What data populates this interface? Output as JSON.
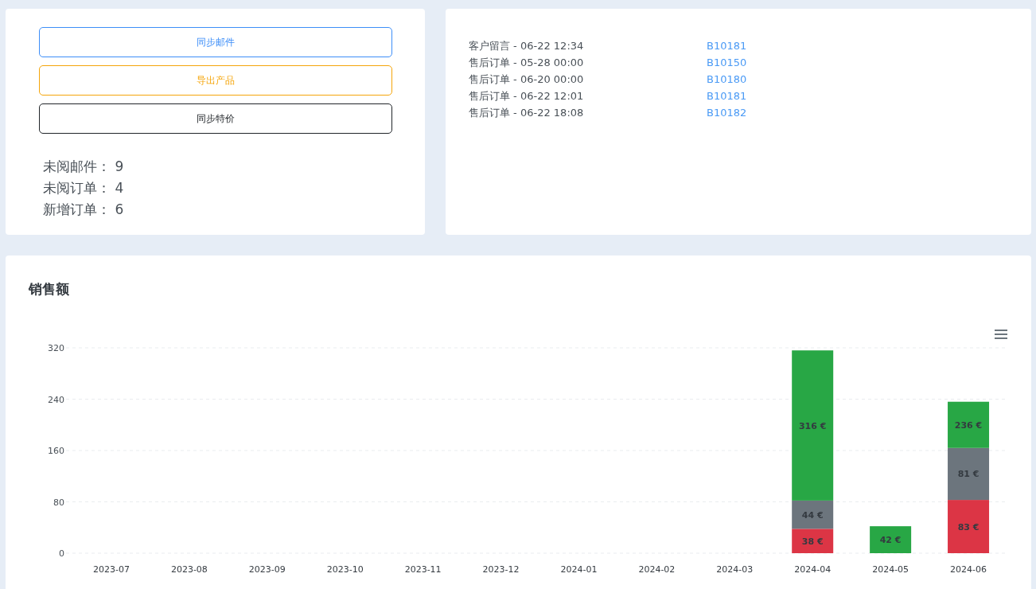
{
  "actions": [
    {
      "label": "同步邮件",
      "color": "#3d8ef8"
    },
    {
      "label": "导出产品",
      "color": "#f5a50a"
    },
    {
      "label": "同步特价",
      "color": "#212529"
    }
  ],
  "stats": [
    {
      "label": "未阅邮件：",
      "value": "9"
    },
    {
      "label": "未阅订单：",
      "value": "4"
    },
    {
      "label": "新增订单：",
      "value": "6"
    }
  ],
  "notifications": [
    {
      "text": "客户留言 - 06-22 12:34",
      "link": "B10181"
    },
    {
      "text": "售后订单 - 05-28 00:00",
      "link": "B10150"
    },
    {
      "text": "售后订单 - 06-20 00:00",
      "link": "B10180"
    },
    {
      "text": "售后订单 - 06-22 12:01",
      "link": "B10181"
    },
    {
      "text": "售后订单 - 06-22 18:08",
      "link": "B10182"
    }
  ],
  "sales": {
    "title": "销售额",
    "chart_data": {
      "type": "bar",
      "stacked": true,
      "categories": [
        "2023-07",
        "2023-08",
        "2023-09",
        "2023-10",
        "2023-11",
        "2023-12",
        "2024-01",
        "2024-02",
        "2024-03",
        "2024-04",
        "2024-05",
        "2024-06"
      ],
      "series": [
        {
          "color": "#dc3545",
          "values": [
            0,
            0,
            0,
            0,
            0,
            0,
            0,
            0,
            0,
            38,
            0,
            83
          ]
        },
        {
          "color": "#6c757d",
          "values": [
            0,
            0,
            0,
            0,
            0,
            0,
            0,
            0,
            0,
            44,
            0,
            81
          ]
        },
        {
          "color": "#28a745",
          "values": [
            0,
            0,
            0,
            0,
            0,
            0,
            0,
            0,
            0,
            234,
            42,
            72
          ]
        }
      ],
      "value_labels": [
        [
          null,
          null,
          null,
          null,
          null,
          null,
          null,
          null,
          null,
          "38 €",
          null,
          "83 €"
        ],
        [
          null,
          null,
          null,
          null,
          null,
          null,
          null,
          null,
          null,
          "44 €",
          null,
          "81 €"
        ],
        [
          null,
          null,
          null,
          null,
          null,
          null,
          null,
          null,
          null,
          "316 €",
          "42 €",
          "236 €"
        ]
      ],
      "ylim": [
        0,
        320
      ],
      "grid": true,
      "yticks": [
        0,
        80,
        160,
        240,
        320
      ]
    }
  }
}
